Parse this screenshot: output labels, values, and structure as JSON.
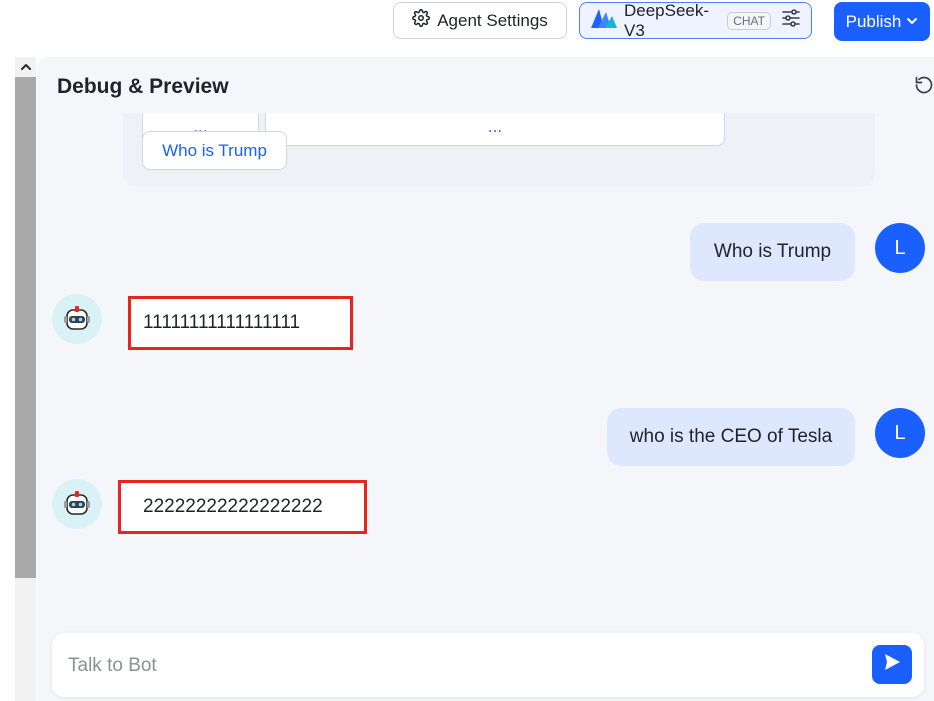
{
  "toolbar": {
    "agent_settings_label": "Agent Settings",
    "model_name": "DeepSeek-V3",
    "model_tag": "CHAT",
    "publish_label": "Publish"
  },
  "panel": {
    "title": "Debug & Preview"
  },
  "suggestions": {
    "chip_1": "...",
    "chip_2": "...",
    "chip_3": "Who is Trump"
  },
  "messages": [
    {
      "role": "user",
      "avatar": "L",
      "text": "Who is Trump"
    },
    {
      "role": "bot",
      "text": "11111111111111111"
    },
    {
      "role": "user",
      "avatar": "L",
      "text": "who is the CEO of Tesla"
    },
    {
      "role": "bot",
      "text": "22222222222222222"
    }
  ],
  "input": {
    "placeholder": "Talk to Bot",
    "value": ""
  },
  "colors": {
    "accent": "#1a5fff",
    "user_bubble": "#dde8ff",
    "highlight_border": "#e5251e",
    "panel_bg": "#f5f6f9"
  }
}
